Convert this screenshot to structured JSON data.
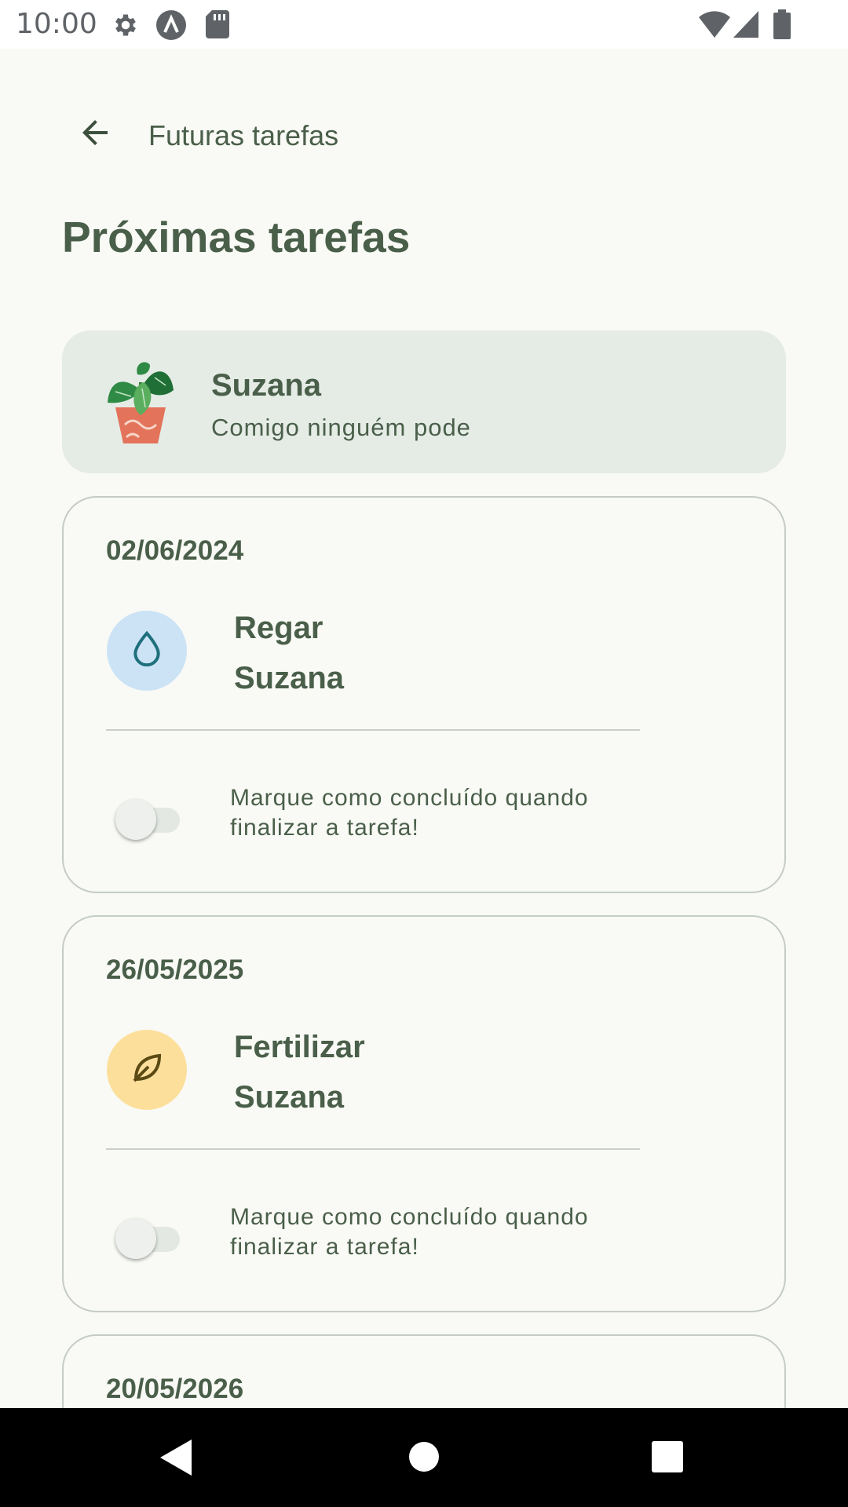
{
  "status_bar": {
    "time": "10:00",
    "icons": [
      "gear-icon",
      "accessibility-icon",
      "sd-card-icon",
      "wifi-icon",
      "signal-icon",
      "battery-icon"
    ]
  },
  "app_bar": {
    "back_icon": "arrow-back-icon",
    "title": "Futuras tarefas"
  },
  "page_title": "Próximas tarefas",
  "plant": {
    "name": "Suzana",
    "species": "Comigo ninguém pode"
  },
  "tasks": [
    {
      "date": "02/06/2024",
      "type": "Regar",
      "plant": "Suzana",
      "icon": "water-drop-icon",
      "icon_bg": "#cce3f6",
      "icon_color": "#1f6f7c",
      "done": false,
      "hint": "Marque como concluído quando finalizar a tarefa!"
    },
    {
      "date": "26/05/2025",
      "type": "Fertilizar",
      "plant": "Suzana",
      "icon": "leaf-icon",
      "icon_bg": "#fddf9c",
      "icon_color": "#5b4a14",
      "done": false,
      "hint": "Marque como concluído quando finalizar a tarefa!"
    },
    {
      "date": "20/05/2026"
    }
  ],
  "colors": {
    "background": "#f9faf5",
    "primary_text": "#4a5f4a",
    "header_card": "#e5ece6",
    "card_border": "#c5cbc5"
  },
  "nav_bar": {
    "buttons": [
      "back-triangle-icon",
      "home-circle-icon",
      "recents-square-icon"
    ]
  }
}
